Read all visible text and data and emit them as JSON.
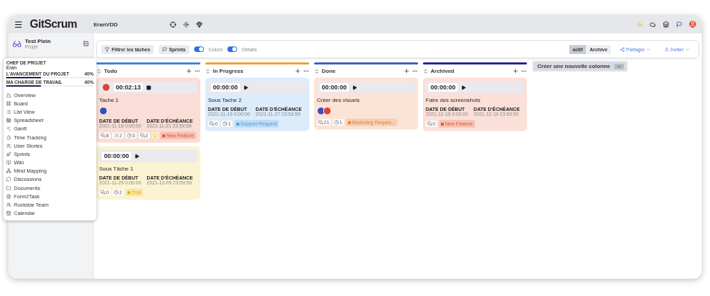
{
  "header": {
    "logo": "GitScrum",
    "workspace": "EranVDD"
  },
  "project": {
    "name": "Test Plein",
    "type": "Projet"
  },
  "project_menu": {
    "owner_label": "CHEF DE PROJET",
    "owner": "Eran",
    "metrics": [
      {
        "label": "L'AVANCEMENT DU PROJET",
        "value": "40%",
        "level": 0.4
      },
      {
        "label": "MA CHARGE DE TRAVAIL",
        "value": "40%",
        "level": 0.4
      }
    ],
    "items": [
      "Overview",
      "Board",
      "List View",
      "Spreadsheet",
      "Gantt",
      "Time Tracking",
      "User Stories",
      "Sprints",
      "Wiki",
      "Mind Mapping",
      "Discussions",
      "Documents",
      "Form2Task",
      "Rockstar Team",
      "Calendar"
    ]
  },
  "toolbar": {
    "filter": "Filtrer les tâches",
    "sprints": "Sprints",
    "toggles": [
      {
        "label": "Colors",
        "on": true
      },
      {
        "label": "Détails",
        "on": true
      }
    ],
    "views": [
      {
        "label": "actif",
        "selected": true
      },
      {
        "label": "Archive",
        "selected": false
      }
    ],
    "share": "Partager",
    "invite": "Inviter"
  },
  "columns": [
    {
      "title": "Todo",
      "color": "#3b82e0",
      "cards": [
        {
          "color": "#f9ddd6",
          "timer": "00:02:13",
          "running": true,
          "owner": {
            "color": "#d9443a"
          },
          "title": "Tache 1",
          "assignees": [
            {
              "color": "#3a4fb8"
            }
          ],
          "start_label": "DATE DE DÉBUT",
          "start": "2021-11-18 0:00:00",
          "due_label": "DATE D'ÉCHÉANCE",
          "due": "2021-11-21 23:59:59",
          "stats": [
            {
              "kind": "comments",
              "value": "8"
            },
            {
              "kind": "checklist",
              "value": "2"
            },
            {
              "kind": "time",
              "value": "3"
            },
            {
              "kind": "comments",
              "value": "2"
            },
            {
              "kind": "star"
            }
          ],
          "tag": {
            "label": "New Feature",
            "color": "#e0572f"
          }
        },
        {
          "color": "#fcf3d2",
          "timer": "00:00:00",
          "running": false,
          "title": "Sous Tâche 1",
          "start_label": "DATE DE DÉBUT",
          "start": "2021-11-29 0:00:00",
          "due_label": "DATE D'ÉCHÉANCE",
          "due": "2021-12-09 23:59:59",
          "stats": [
            {
              "kind": "comments",
              "value": "0"
            },
            {
              "kind": "time",
              "value": "2"
            }
          ],
          "tag": {
            "label": "Trial",
            "color": "#e8b400"
          }
        }
      ]
    },
    {
      "title": "In Progress",
      "color": "#f0a030",
      "cards": [
        {
          "color": "#dcecfb",
          "timer": "00:00:00",
          "running": false,
          "title": "Sous Tache 2",
          "start_label": "DATE DE DÉBUT",
          "start": "2021-11-19 0:00:00",
          "due_label": "DATE D'ÉCHÉANCE",
          "due": "2021-11-27 23:59:59",
          "stats": [
            {
              "kind": "comments",
              "value": "0"
            },
            {
              "kind": "time",
              "value": "1"
            }
          ],
          "tag": {
            "label": "Support Request",
            "color": "#4a9be0"
          }
        }
      ]
    },
    {
      "title": "Done",
      "color": "#3a5fc8",
      "cards": [
        {
          "color": "#fbe3d6",
          "timer": "00:00:00",
          "running": false,
          "title": "Créer des visuels",
          "assignees": [
            {
              "color": "#3a4fb8"
            },
            {
              "color": "#d9443a"
            }
          ],
          "stats": [
            {
              "kind": "comments",
              "value": "21"
            },
            {
              "kind": "time",
              "value": "1"
            }
          ],
          "tag": {
            "label": "Marketing Reques...",
            "color": "#e8822f"
          }
        }
      ]
    },
    {
      "title": "Archived",
      "color": "#22229a",
      "cards": [
        {
          "color": "#fbe0d8",
          "timer": "00:00:00",
          "running": false,
          "title": "Faire des screenshots",
          "start_label": "DATE DE DÉBUT",
          "start": "2021-12-15 0:00:00",
          "due_label": "DATE D'ÉCHÉANCE",
          "due": "2021-12-19 23:59:59",
          "stats": [
            {
              "kind": "comments",
              "value": "0"
            }
          ],
          "tag": {
            "label": "New Feature",
            "color": "#e0572f"
          }
        }
      ]
    }
  ],
  "new_column": {
    "label": "Créer une nouvelle colonne"
  }
}
